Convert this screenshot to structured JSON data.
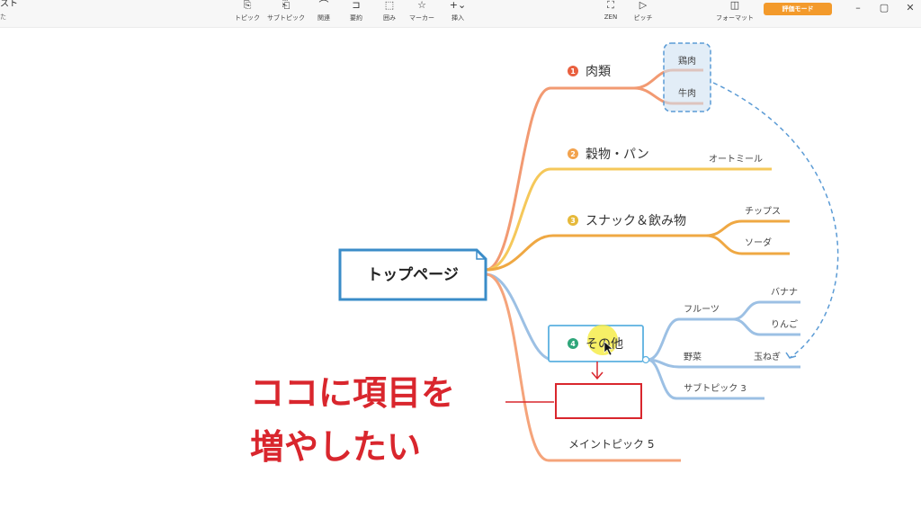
{
  "toolbar": {
    "app_title": "スト",
    "app_sub": "た",
    "buttons": [
      {
        "label": "トピック",
        "icon": "topic-icon"
      },
      {
        "label": "サブトピック",
        "icon": "subtopic-icon"
      },
      {
        "label": "関連",
        "icon": "relation-icon"
      },
      {
        "label": "要約",
        "icon": "summary-icon"
      },
      {
        "label": "囲み",
        "icon": "boundary-icon"
      },
      {
        "label": "マーカー",
        "icon": "marker-icon"
      },
      {
        "label": "挿入",
        "icon": "insert-icon"
      }
    ],
    "right_buttons": [
      {
        "label": "ZEN",
        "icon": "zen-icon"
      },
      {
        "label": "ピッチ",
        "icon": "pitch-icon"
      },
      {
        "label": "フォーマット",
        "icon": "format-icon"
      }
    ],
    "trial_label": "評価モード"
  },
  "mindmap": {
    "root": "トップページ",
    "topics": [
      {
        "num": "1",
        "label": "肉類",
        "color": "#e9603f",
        "children": [
          "鶏肉",
          "牛肉"
        ]
      },
      {
        "num": "2",
        "label": "穀物・パン",
        "color": "#f2a24d",
        "children": [
          "オートミール"
        ]
      },
      {
        "num": "3",
        "label": "スナック＆飲み物",
        "color": "#e6b93a",
        "children": [
          "チップス",
          "ソーダ"
        ]
      },
      {
        "num": "4",
        "label": "その他",
        "color": "#2fa67a",
        "children": [
          "フルーツ",
          "野菜",
          "サブトピック 3"
        ],
        "grandchildren": {
          "fruit": [
            "バナナ",
            "りんご"
          ],
          "veg": [
            "玉ねぎ"
          ]
        }
      },
      {
        "label": "メイントピック 5"
      }
    ]
  },
  "annotation": {
    "line1": "ココに項目を",
    "line2": "増やしたい"
  },
  "colors": {
    "meat": "#f29a72",
    "grain": "#f5c85a",
    "snack": "#efa843",
    "other": "#9cc0e4",
    "main5": "#f5a47b",
    "annotation": "#d9262d",
    "root_border": "#3a8cc8"
  }
}
